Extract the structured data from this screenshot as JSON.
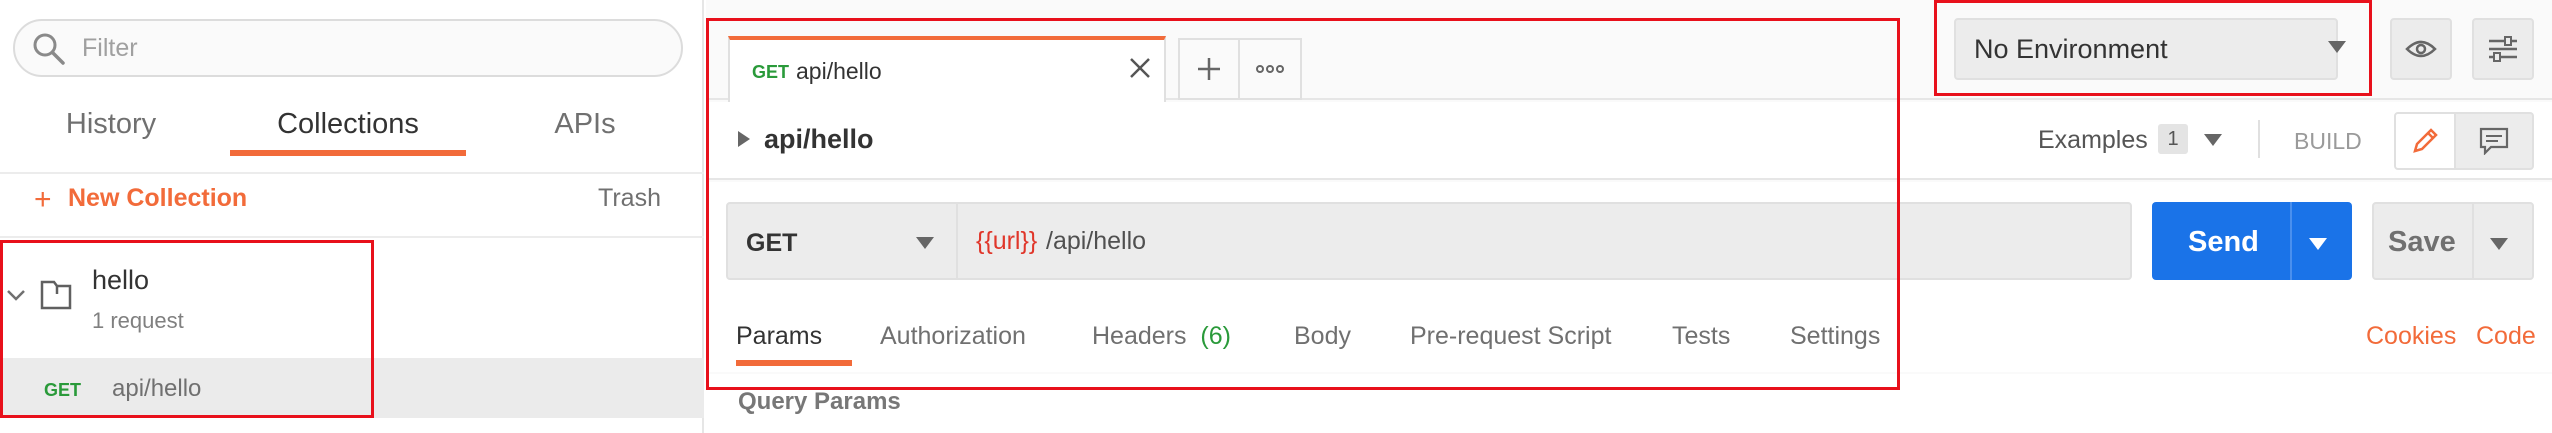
{
  "sidebar": {
    "filter": {
      "placeholder": "Filter"
    },
    "tabs": {
      "history": "History",
      "collections": "Collections",
      "apis": "APIs"
    },
    "new_collection": {
      "plus": "+",
      "label": "New Collection"
    },
    "trash_label": "Trash",
    "collection": {
      "name": "hello",
      "count": "1 request"
    },
    "request": {
      "method": "GET",
      "name": "api/hello"
    }
  },
  "tabs_bar": {
    "active_tab": {
      "method": "GET",
      "name": "api/hello"
    }
  },
  "environment": {
    "selected": "No Environment"
  },
  "request_header": {
    "title": "api/hello",
    "examples_label": "Examples",
    "examples_count": "1",
    "build_label": "BUILD"
  },
  "url_bar": {
    "method": "GET",
    "url_variable": "{{url}}",
    "url_path": "/api/hello",
    "send_label": "Send",
    "save_label": "Save"
  },
  "request_tabs": {
    "params": "Params",
    "authorization": "Authorization",
    "headers": "Headers",
    "headers_count": "(6)",
    "body": "Body",
    "pre_request": "Pre-request Script",
    "tests": "Tests",
    "settings": "Settings",
    "cookies": "Cookies",
    "code": "Code"
  },
  "params_section": {
    "title": "Query Params"
  },
  "colors": {
    "accent": "#f26b3a",
    "send_blue": "#1a73e8",
    "get_green": "#2a9a3a",
    "variable_red": "#e0362a",
    "annotation_red": "#e8101b"
  }
}
